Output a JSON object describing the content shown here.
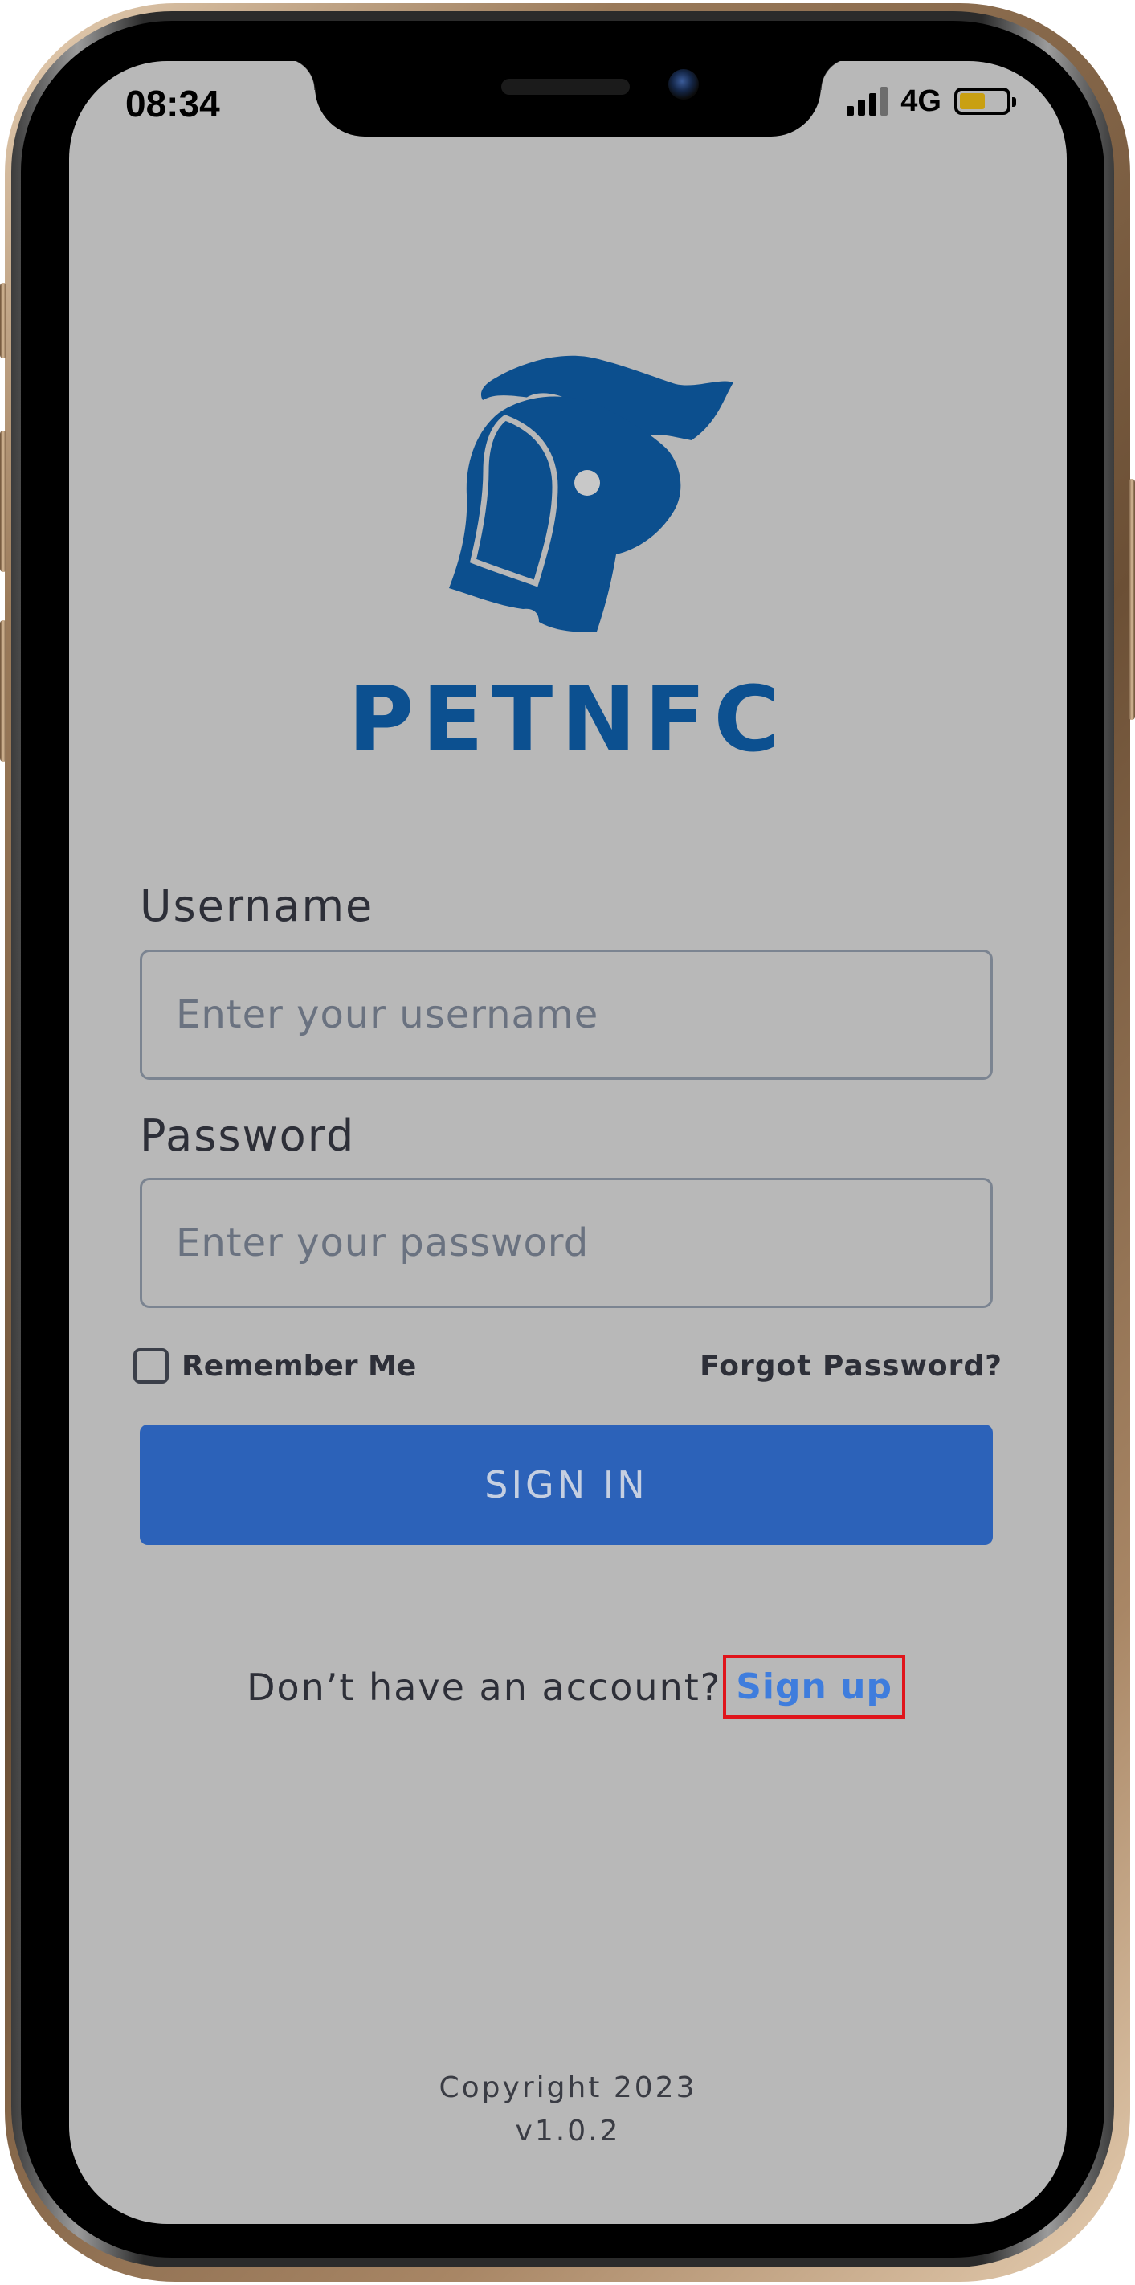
{
  "status_bar": {
    "time": "08:34",
    "network": "4G",
    "battery_level": 0.55
  },
  "brand": {
    "name": "PETNFC",
    "logo_icon": "pet-hand-icon",
    "color": "#0c5090"
  },
  "form": {
    "username_label": "Username",
    "username_placeholder": "Enter your username",
    "username_value": "",
    "password_label": "Password",
    "password_placeholder": "Enter your password",
    "password_value": "",
    "remember_label": "Remember Me",
    "remember_checked": false,
    "forgot_label": "Forgot Password?",
    "signin_label": "SIGN IN",
    "signin_color": "#2c62b9"
  },
  "signup": {
    "prompt": "Don’t have an account?",
    "link_label": "Sign up",
    "link_color": "#3f7ddd",
    "highlight_color": "#e0141b"
  },
  "footer": {
    "copyright": "Copyright 2023",
    "version": "v1.0.2"
  }
}
